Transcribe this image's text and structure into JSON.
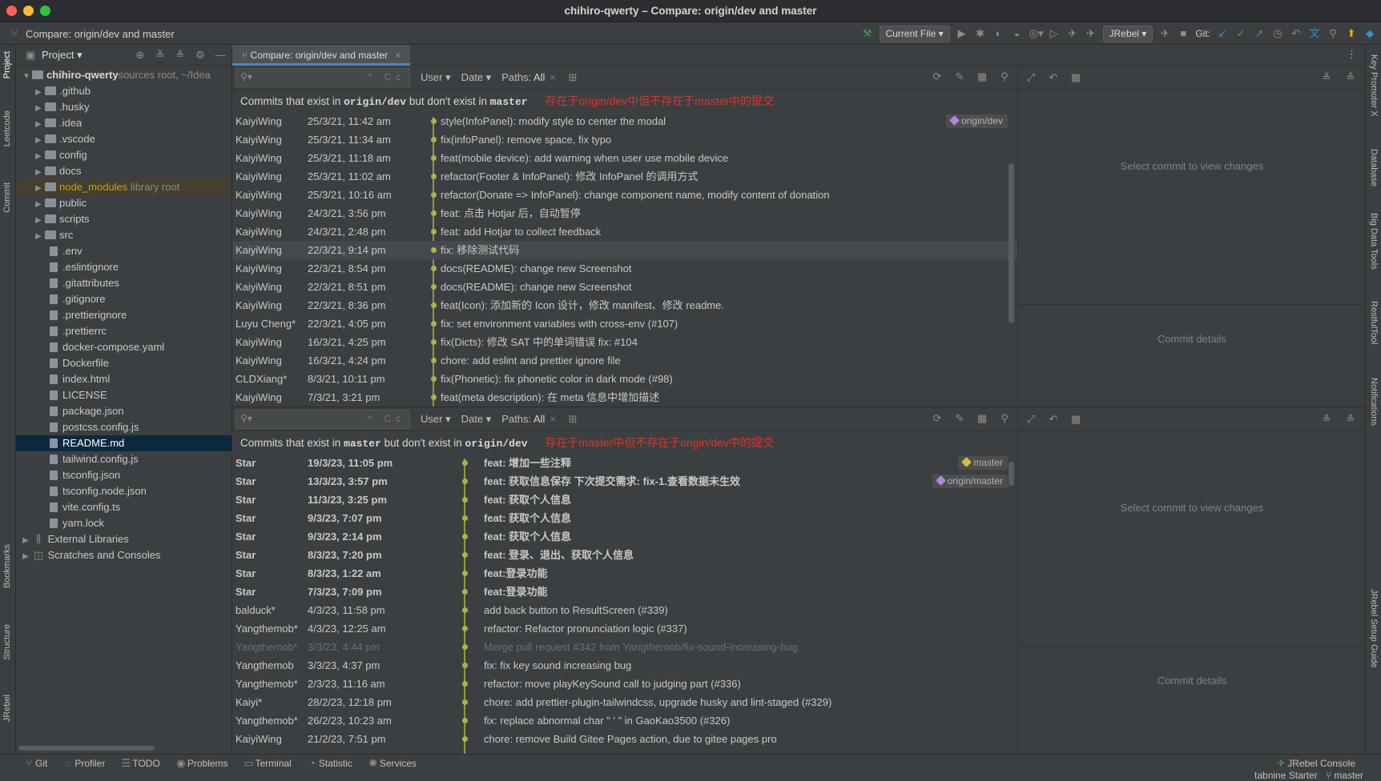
{
  "window": {
    "title": "chihiro-qwerty – Compare: origin/dev and master"
  },
  "toolbar": {
    "breadcrumb": "Compare: origin/dev and master",
    "run_config": "Current File",
    "jrebel": "JRebel",
    "git_label": "Git:"
  },
  "left_strip": [
    "Project",
    "Leetcode",
    "Commit",
    "Bookmarks",
    "Structure",
    "JRebel"
  ],
  "right_strip": [
    "Key Promoter X",
    "Database",
    "Big Data Tools",
    "RestfulTool",
    "Notifications",
    "JRebel Setup Guide"
  ],
  "project": {
    "title": "Project",
    "root": {
      "name": "chihiro-qwerty",
      "hint": "sources root, ~/Idea"
    },
    "items": [
      {
        "name": ".github",
        "kind": "folder"
      },
      {
        "name": ".husky",
        "kind": "folder"
      },
      {
        "name": ".idea",
        "kind": "folder"
      },
      {
        "name": ".vscode",
        "kind": "folder"
      },
      {
        "name": "config",
        "kind": "folder"
      },
      {
        "name": "docs",
        "kind": "folder"
      },
      {
        "name": "node_modules",
        "kind": "folder",
        "hint": "library root"
      },
      {
        "name": "public",
        "kind": "folder"
      },
      {
        "name": "scripts",
        "kind": "folder"
      },
      {
        "name": "src",
        "kind": "folder"
      },
      {
        "name": ".env",
        "kind": "file"
      },
      {
        "name": ".eslintignore",
        "kind": "file"
      },
      {
        "name": ".gitattributes",
        "kind": "file"
      },
      {
        "name": ".gitignore",
        "kind": "file"
      },
      {
        "name": ".prettierignore",
        "kind": "file"
      },
      {
        "name": ".prettierrc",
        "kind": "file"
      },
      {
        "name": "docker-compose.yaml",
        "kind": "file"
      },
      {
        "name": "Dockerfile",
        "kind": "file"
      },
      {
        "name": "index.html",
        "kind": "file"
      },
      {
        "name": "LICENSE",
        "kind": "file"
      },
      {
        "name": "package.json",
        "kind": "file"
      },
      {
        "name": "postcss.config.js",
        "kind": "file"
      },
      {
        "name": "README.md",
        "kind": "file",
        "selected": true
      },
      {
        "name": "tailwind.config.js",
        "kind": "file"
      },
      {
        "name": "tsconfig.json",
        "kind": "file"
      },
      {
        "name": "tsconfig.node.json",
        "kind": "file"
      },
      {
        "name": "vite.config.ts",
        "kind": "file"
      },
      {
        "name": "yarn.lock",
        "kind": "file"
      }
    ],
    "external": "External Libraries",
    "scratches": "Scratches and Consoles"
  },
  "tab": {
    "label": "Compare: origin/dev and master"
  },
  "filters": {
    "user": "User",
    "date": "Date",
    "paths": "Paths:",
    "paths_value": "All"
  },
  "top": {
    "headline_pre": "Commits that exist in",
    "headline_a": "origin/dev",
    "headline_mid": "but don't exist in",
    "headline_b": "master",
    "annotation": "存在于origin/dev中但不存在于master中的提交",
    "commits": [
      {
        "author": "KaiyiWing",
        "date": "25/3/21, 11:42 am",
        "msg": "style(InfoPanel): modify style to center the modal",
        "tag": "origin/dev"
      },
      {
        "author": "KaiyiWing",
        "date": "25/3/21, 11:34 am",
        "msg": "fix(infoPanel): remove space, fix typo"
      },
      {
        "author": "KaiyiWing",
        "date": "25/3/21, 11:18 am",
        "msg": "feat(mobile device): add warning when user use mobile device"
      },
      {
        "author": "KaiyiWing",
        "date": "25/3/21, 11:02 am",
        "msg": "refactor(Footer & InfoPanel): 修改 InfoPanel 的调用方式"
      },
      {
        "author": "KaiyiWing",
        "date": "25/3/21, 10:16 am",
        "msg": "refactor(Donate => InfoPanel): change component name, modify content of donation"
      },
      {
        "author": "KaiyiWing",
        "date": "24/3/21, 3:56 pm",
        "msg": "feat: 点击 Hotjar 后，自动暂停"
      },
      {
        "author": "KaiyiWing",
        "date": "24/3/21, 2:48 pm",
        "msg": "feat: add Hotjar to collect feedback"
      },
      {
        "author": "KaiyiWing",
        "date": "22/3/21, 9:14 pm",
        "msg": "fix: 移除测试代码",
        "hover": true
      },
      {
        "author": "KaiyiWing",
        "date": "22/3/21, 8:54 pm",
        "msg": "docs(README): change new Screenshot"
      },
      {
        "author": "KaiyiWing",
        "date": "22/3/21, 8:51 pm",
        "msg": "docs(README): change new Screenshot"
      },
      {
        "author": "KaiyiWing",
        "date": "22/3/21, 8:36 pm",
        "msg": "feat(Icon): 添加新的 Icon 设计，修改 manifest、修改 readme."
      },
      {
        "author": "Luyu Cheng*",
        "date": "22/3/21, 4:05 pm",
        "msg": "fix: set environment variables with cross-env (#107)"
      },
      {
        "author": "KaiyiWing",
        "date": "16/3/21, 4:25 pm",
        "msg": "fix(Dicts): 修改 SAT 中的单词错误 fix: #104"
      },
      {
        "author": "KaiyiWing",
        "date": "16/3/21, 4:24 pm",
        "msg": "chore: add eslint and prettier ignore file"
      },
      {
        "author": "CLDXiang*",
        "date": "8/3/21, 10:11 pm",
        "msg": "fix(Phonetic): fix phonetic color in dark mode (#98)"
      },
      {
        "author": "KaiyiWing",
        "date": "7/3/21, 3:21 pm",
        "msg": "feat(meta description): 在 meta 信息中增加描述"
      }
    ]
  },
  "bottom": {
    "headline_pre": "Commits that exist in",
    "headline_a": "master",
    "headline_mid": "but don't exist in",
    "headline_b": "origin/dev",
    "annotation": "存在于master中但不存在于origin/dev中的提交",
    "commits": [
      {
        "author": "Star",
        "date": "19/3/23, 11:05 pm",
        "msg": "feat:  增加一些注释",
        "tag": "master",
        "bold": true
      },
      {
        "author": "Star",
        "date": "13/3/23, 3:57 pm",
        "msg": "feat:  获取信息保存 下次提交需求:  fix-1.查看数据未生效",
        "tag": "origin/master",
        "bold": true
      },
      {
        "author": "Star",
        "date": "11/3/23, 3:25 pm",
        "msg": "feat: 获取个人信息",
        "bold": true
      },
      {
        "author": "Star",
        "date": "9/3/23, 7:07 pm",
        "msg": "feat:  获取个人信息",
        "bold": true
      },
      {
        "author": "Star",
        "date": "9/3/23, 2:14 pm",
        "msg": "feat:  获取个人信息",
        "bold": true
      },
      {
        "author": "Star",
        "date": "8/3/23, 7:20 pm",
        "msg": "feat:  登录、退出、获取个人信息",
        "bold": true
      },
      {
        "author": "Star",
        "date": "8/3/23, 1:22 am",
        "msg": "feat:登录功能",
        "bold": true
      },
      {
        "author": "Star",
        "date": "7/3/23, 7:09 pm",
        "msg": "feat:登录功能",
        "bold": true
      },
      {
        "author": "balduck*",
        "date": "4/3/23, 11:58 pm",
        "msg": "add back button to ResultScreen (#339)"
      },
      {
        "author": "Yangthemob*",
        "date": "4/3/23, 12:25 am",
        "msg": "refactor: Refactor pronunciation logic (#337)"
      },
      {
        "author": "Yangthemob*",
        "date": "3/3/23, 4:44 pm",
        "msg": "Merge pull request #342 from Yangthemob/fix-sound-increasing-bug",
        "dim": true
      },
      {
        "author": "Yangthemob",
        "date": "3/3/23, 4:37 pm",
        "msg": "fix: fix key sound increasing bug"
      },
      {
        "author": "Yangthemob*",
        "date": "2/3/23, 11:16 am",
        "msg": "refactor: move playKeySound call to judging part (#336)"
      },
      {
        "author": "Kaiyi*",
        "date": "28/2/23, 12:18 pm",
        "msg": "chore: add prettier-plugin-tailwindcss, upgrade husky and lint-staged (#329)"
      },
      {
        "author": "Yangthemob*",
        "date": "26/2/23, 10:23 am",
        "msg": "fix: replace abnormal char \" ' \" in GaoKao3500 (#326)"
      },
      {
        "author": "KaiyiWing",
        "date": "21/2/23, 7:51 pm",
        "msg": "chore: remove Build Gitee Pages action, due to gitee pages pro"
      }
    ]
  },
  "details": {
    "select": "Select commit to view changes",
    "details": "Commit details"
  },
  "bottombar": {
    "git": "Git",
    "profiler": "Profiler",
    "todo": "TODO",
    "problems": "Problems",
    "terminal": "Terminal",
    "statistic": "Statistic",
    "services": "Services",
    "jrebel_console": "JRebel Console"
  },
  "statusbar": {
    "tabnine": "tabnine Starter",
    "branch": "master"
  }
}
